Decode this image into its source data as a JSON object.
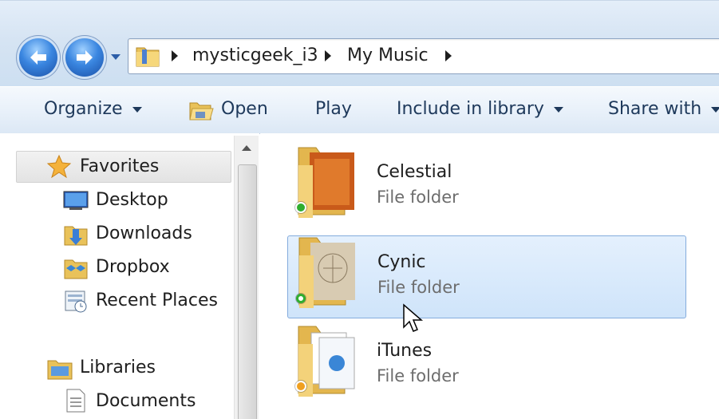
{
  "address": {
    "crumbs": [
      "mysticgeek_i3",
      "My Music"
    ]
  },
  "toolbar": {
    "organize": "Organize",
    "open": "Open",
    "play": "Play",
    "include": "Include in library",
    "share": "Share with"
  },
  "nav": {
    "favorites": "Favorites",
    "desktop": "Desktop",
    "downloads": "Downloads",
    "dropbox": "Dropbox",
    "recent": "Recent Places",
    "libraries": "Libraries",
    "documents": "Documents"
  },
  "files": [
    {
      "name": "Celestial",
      "type": "File folder",
      "status_color": "#2fae2f"
    },
    {
      "name": "Cynic",
      "type": "File folder",
      "status_color": "#2fae2f"
    },
    {
      "name": "iTunes",
      "type": "File folder",
      "status_color": "#f0a020"
    }
  ],
  "icons": [
    "back-arrow-icon",
    "forward-arrow-icon",
    "folder-icon",
    "star-icon",
    "desktop-icon",
    "downloads-icon",
    "dropbox-icon",
    "recent-places-icon",
    "libraries-icon",
    "documents-icon",
    "mouse-cursor-icon"
  ]
}
